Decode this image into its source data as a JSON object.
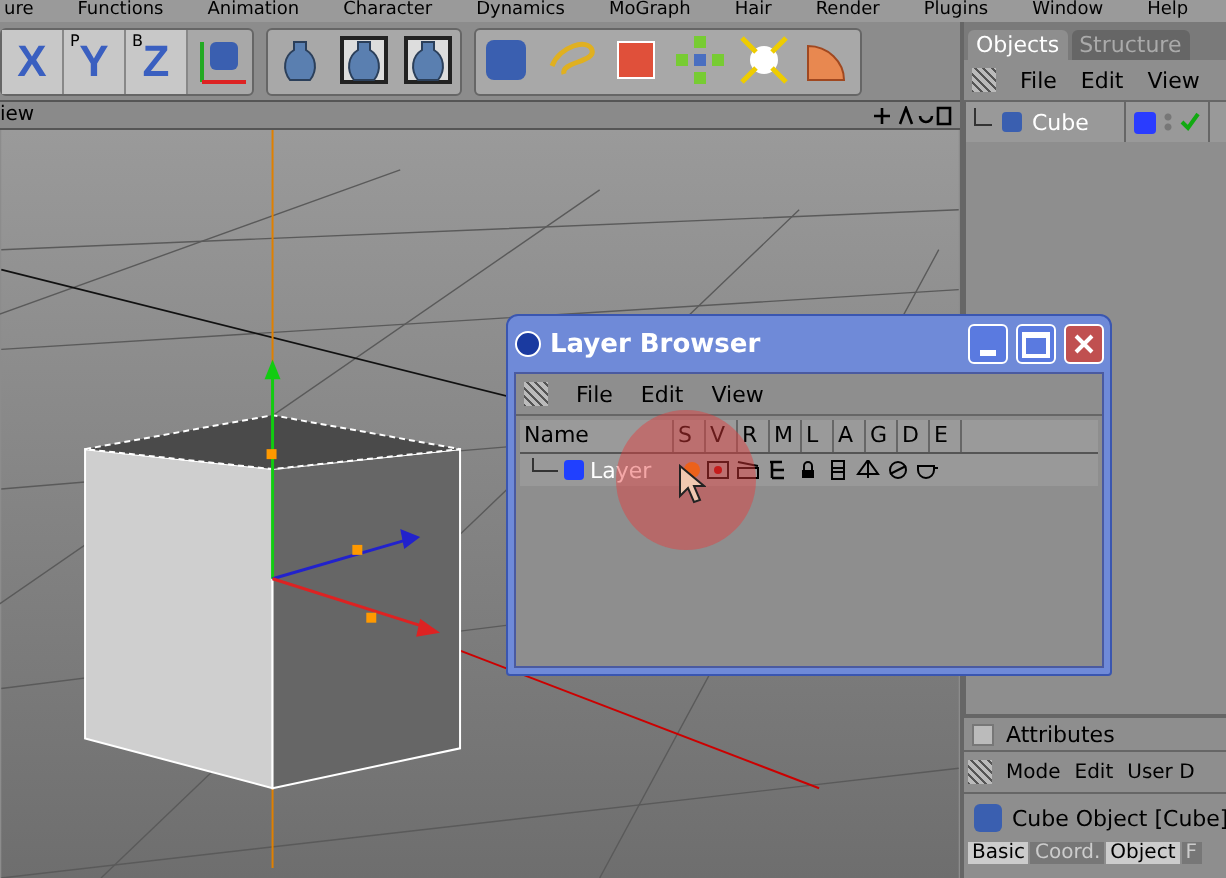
{
  "menu_bar": [
    "ure",
    "Functions",
    "Animation",
    "Character",
    "Dynamics",
    "MoGraph",
    "Hair",
    "Render",
    "Plugins",
    "Window",
    "Help"
  ],
  "toolbar": {
    "axis_buttons": [
      {
        "letter": "X"
      },
      {
        "letter": "Y",
        "sub": "P"
      },
      {
        "letter": "Z",
        "sub": "B"
      }
    ]
  },
  "viewport": {
    "title": "iew"
  },
  "objects_panel": {
    "tabs": [
      {
        "label": "Objects",
        "selected": true
      },
      {
        "label": "Structure",
        "selected": false
      }
    ],
    "menu": [
      "File",
      "Edit",
      "View"
    ],
    "objects": [
      {
        "name": "Cube",
        "color": "#2a3cff",
        "checked": true
      }
    ]
  },
  "attributes": {
    "title": "Attributes",
    "menu": [
      "Mode",
      "Edit",
      "User D"
    ],
    "object_title": "Cube Object [Cube]",
    "tabs": [
      {
        "label": "Basic",
        "selected": true
      },
      {
        "label": "Coord.",
        "selected": false
      },
      {
        "label": "Object",
        "selected": true
      },
      {
        "label": "F",
        "selected": false
      }
    ]
  },
  "layer_browser": {
    "title": "Layer Browser",
    "menu": [
      "File",
      "Edit",
      "View"
    ],
    "columns": [
      "Name",
      "S",
      "V",
      "R",
      "M",
      "L",
      "A",
      "G",
      "D",
      "E"
    ],
    "layers": [
      {
        "name": "Layer",
        "color": "#2040ff",
        "solo": true
      }
    ]
  }
}
